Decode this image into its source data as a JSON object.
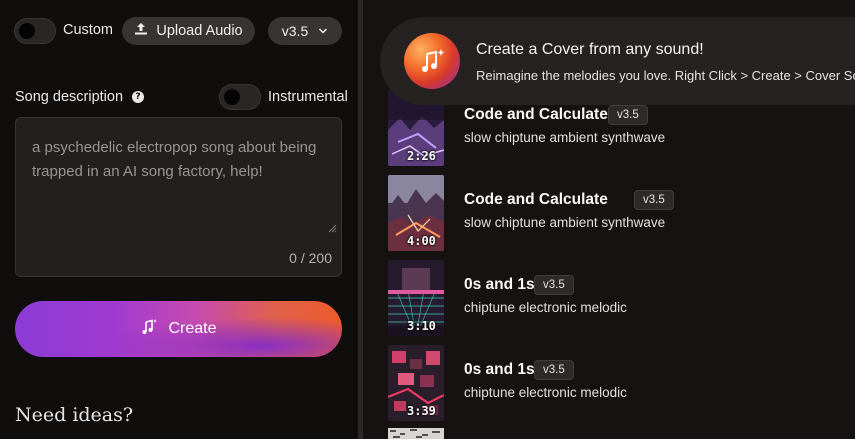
{
  "controls": {
    "custom_label": "Custom",
    "upload_label": "Upload Audio",
    "version_label": "v3.5",
    "upload_icon": "upload-icon",
    "chevron_icon": "chevron-down-icon"
  },
  "description": {
    "label": "Song description",
    "help_icon": "question-icon",
    "help_glyph": "?",
    "instrumental_label": "Instrumental",
    "placeholder": "a psychedelic electropop song about being trapped in an AI song factory, help!",
    "counter": "0 / 200"
  },
  "create": {
    "label": "Create",
    "icon": "music-sparkle-icon"
  },
  "ideas": {
    "heading": "Need ideas?"
  },
  "banner": {
    "title": "Create a Cover from any sound!",
    "subtitle": "Reimagine the melodies you love. Right Click > Create > Cover Song"
  },
  "clips": [
    {
      "title": "Code and Calculate",
      "version": "v3.5",
      "tags": "slow chiptune ambient synthwave",
      "duration": "2:26"
    },
    {
      "title": "Code and Calculate",
      "version": "v3.5",
      "tags": "slow chiptune ambient synthwave",
      "duration": "4:00"
    },
    {
      "title": "0s and 1s",
      "version": "v3.5",
      "tags": "chiptune electronic melodic",
      "duration": "3:10"
    },
    {
      "title": "0s and 1s",
      "version": "v3.5",
      "tags": "chiptune electronic melodic",
      "duration": "3:39"
    }
  ],
  "colors": {
    "accent_purple": "#8c3bd6",
    "accent_orange": "#ee5a2b",
    "background": "#0f0c0c",
    "panel": "#161212"
  }
}
